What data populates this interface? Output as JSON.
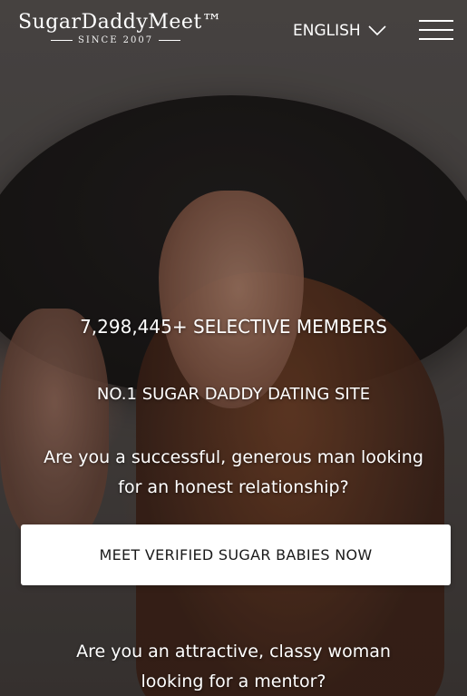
{
  "header": {
    "logo": {
      "name": "SugarDaddyMeet™",
      "since": "SINCE 2007"
    },
    "language": {
      "label": "ENGLISH",
      "icon": "chevron-down-icon"
    },
    "menu_icon": "hamburger-menu-icon"
  },
  "hero": {
    "members": "7,298,445+ SELECTIVE MEMBERS",
    "tagline": "NO.1 SUGAR DADDY DATING SITE",
    "question_men_line1": "Are you a successful, generous man looking",
    "question_men_line2": "for an honest relationship?",
    "cta_label": "MEET VERIFIED SUGAR BABIES NOW",
    "question_women_line1": "Are you an attractive, classy woman",
    "question_women_line2": "looking for a mentor?"
  },
  "colors": {
    "cta_background": "#ffffff",
    "text": "#ffffff"
  }
}
